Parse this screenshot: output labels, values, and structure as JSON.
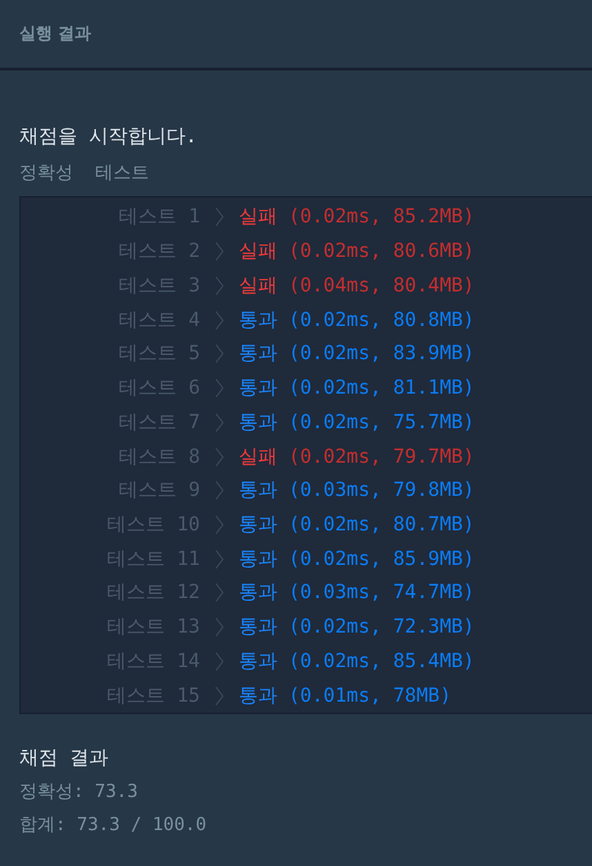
{
  "header": {
    "title": "실행 결과"
  },
  "intro": "채점을 시작합니다.",
  "section_title": [
    "정확성",
    "테스트"
  ],
  "tests": [
    {
      "label": "테스트 1",
      "kind": "fail",
      "status": "실패",
      "detail": "(0.02ms, 85.2MB)"
    },
    {
      "label": "테스트 2",
      "kind": "fail",
      "status": "실패",
      "detail": "(0.02ms, 80.6MB)"
    },
    {
      "label": "테스트 3",
      "kind": "fail",
      "status": "실패",
      "detail": "(0.04ms, 80.4MB)"
    },
    {
      "label": "테스트 4",
      "kind": "pass",
      "status": "통과",
      "detail": "(0.02ms, 80.8MB)"
    },
    {
      "label": "테스트 5",
      "kind": "pass",
      "status": "통과",
      "detail": "(0.02ms, 83.9MB)"
    },
    {
      "label": "테스트 6",
      "kind": "pass",
      "status": "통과",
      "detail": "(0.02ms, 81.1MB)"
    },
    {
      "label": "테스트 7",
      "kind": "pass",
      "status": "통과",
      "detail": "(0.02ms, 75.7MB)"
    },
    {
      "label": "테스트 8",
      "kind": "fail",
      "status": "실패",
      "detail": "(0.02ms, 79.7MB)"
    },
    {
      "label": "테스트 9",
      "kind": "pass",
      "status": "통과",
      "detail": "(0.03ms, 79.8MB)"
    },
    {
      "label": "테스트 10",
      "kind": "pass",
      "status": "통과",
      "detail": "(0.02ms, 80.7MB)"
    },
    {
      "label": "테스트 11",
      "kind": "pass",
      "status": "통과",
      "detail": "(0.02ms, 85.9MB)"
    },
    {
      "label": "테스트 12",
      "kind": "pass",
      "status": "통과",
      "detail": "(0.03ms, 74.7MB)"
    },
    {
      "label": "테스트 13",
      "kind": "pass",
      "status": "통과",
      "detail": "(0.02ms, 72.3MB)"
    },
    {
      "label": "테스트 14",
      "kind": "pass",
      "status": "통과",
      "detail": "(0.02ms, 85.4MB)"
    },
    {
      "label": "테스트 15",
      "kind": "pass",
      "status": "통과",
      "detail": "(0.01ms, 78MB)"
    }
  ],
  "summary": {
    "title": "채점 결과",
    "lines": [
      "정확성: 73.3",
      "합계: 73.3 / 100.0"
    ]
  }
}
